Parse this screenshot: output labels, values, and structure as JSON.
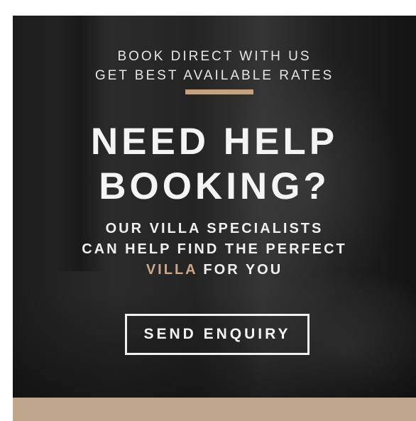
{
  "banner": {
    "kicker_line1": "BOOK DIRECT WITH US",
    "kicker_line2": "GET BEST AVAILABLE RATES",
    "headline_line1": "NEED HELP",
    "headline_line2": "BOOKING?",
    "sub_line1": "OUR VILLA SPECIALISTS",
    "sub_line2": "CAN HELP FIND THE PERFECT",
    "sub_highlight": "VILLA",
    "sub_line3_rest": " FOR YOU",
    "cta_label": "SEND ENQUIRY"
  },
  "colors": {
    "accent": "#c2a283",
    "footer_bar": "#c0a68c",
    "background": "#222222"
  }
}
